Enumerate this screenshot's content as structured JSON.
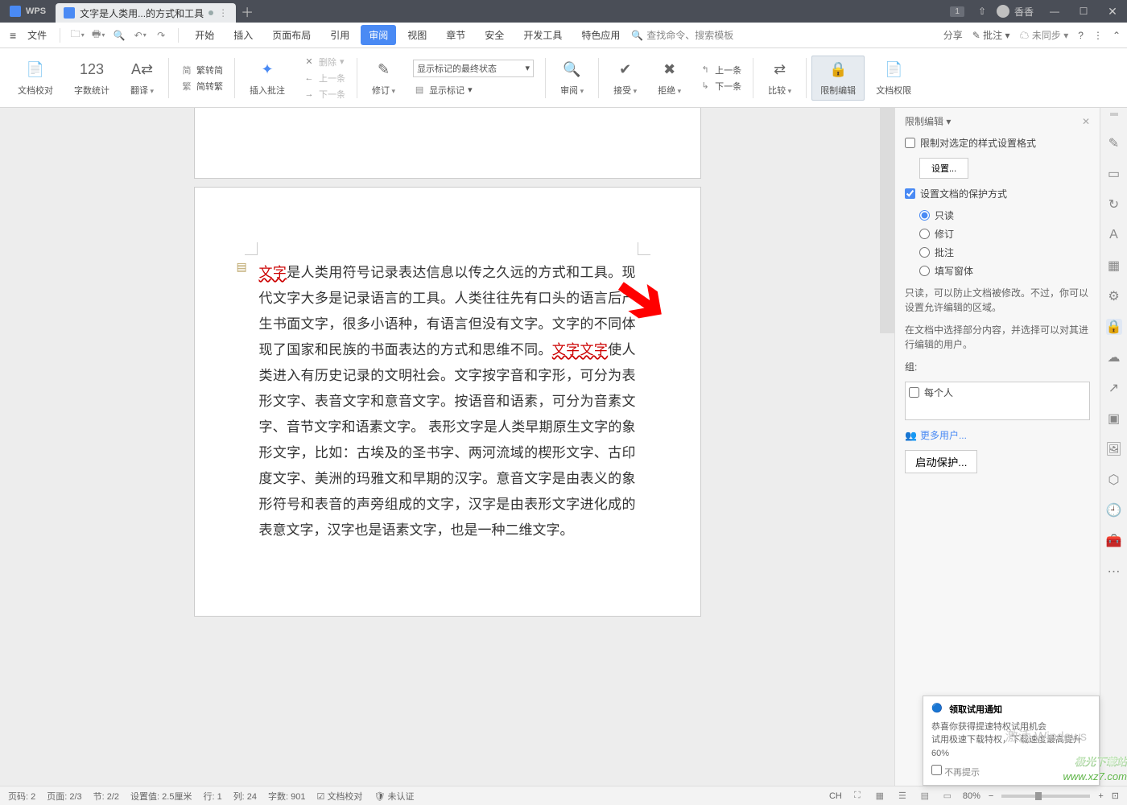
{
  "app": {
    "name": "WPS",
    "tab_title": "文字是人类用...的方式和工具",
    "user": "香香"
  },
  "window_controls": {
    "badge": "1"
  },
  "menubar": {
    "file": "文件",
    "items": [
      "开始",
      "插入",
      "页面布局",
      "引用",
      "审阅",
      "视图",
      "章节",
      "安全",
      "开发工具",
      "特色应用"
    ],
    "active": "审阅",
    "search": "查找命令、搜索模板",
    "share": "分享",
    "comment": "批注",
    "unsynced": "未同步"
  },
  "ribbon": {
    "doc_check": "文档校对",
    "word_count": "字数统计",
    "translate": "翻译",
    "s2t": "繁转简",
    "t2s": "简转繁",
    "insert_comment": "插入批注",
    "delete": "删除",
    "prev_comment": "上一条",
    "next_comment": "下一条",
    "revise": "修订",
    "markup_state": "显示标记的最终状态",
    "show_markup": "显示标记",
    "review": "审阅",
    "accept": "接受",
    "reject": "拒绝",
    "prev_change": "上一条",
    "next_change": "下一条",
    "compare": "比较",
    "restrict_edit": "限制编辑",
    "doc_perm": "文档权限"
  },
  "document": {
    "text1_red": "文字",
    "text1": "是人类用符号记录表达信息以传之久远的方式和工具。现代文字大多是记录语言的工具。人类往往先有口头的语言后产生书面文字，很多小语种，有语言但没有文字。文字的不同体现了国家和民族的书面表达的方式和思维不同。",
    "text2_red": "文字文字",
    "text2": "使人类进入有历史记录的文明社会。文字按字音和字形，可分为表形文字、表音文字和意音文字。按语音和语素，可分为音素文字、音节文字和语素文字。 表形文字是人类早期原生文字的象形文字，比如：古埃及的圣书字、两河流域的楔形文字、古印度文字、美洲的玛雅文和早期的汉字。意音文字是由表义的象形符号和表音的声旁组成的文字，汉字是由表形文字进化成的表意文字，汉字也是语素文字，也是一种二维文字。"
  },
  "panel": {
    "title": "限制编辑",
    "restrict_style": "限制对选定的样式设置格式",
    "settings": "设置...",
    "set_protect": "设置文档的保护方式",
    "readonly": "只读",
    "revise_r": "修订",
    "comment_r": "批注",
    "form_r": "填写窗体",
    "readonly_hint": "只读，可以防止文档被修改。不过，你可以设置允许编辑的区域。",
    "select_hint": "在文档中选择部分内容，并选择可以对其进行编辑的用户。",
    "group_label": "组:",
    "everyone": "每个人",
    "more_users": "更多用户...",
    "start_protect": "启动保护..."
  },
  "notice": {
    "title": "领取试用通知",
    "line1": "恭喜你获得提速特权试用机会",
    "line2": "试用极速下载特权，下载速度最高提升60%",
    "no_remind": "不再提示"
  },
  "watermark": "激活 Windows",
  "site": {
    "l1": "极光下载站",
    "l2": "www.xz7.com"
  },
  "statusbar": {
    "page_no": "页码: 2",
    "page": "页面: 2/3",
    "section": "节: 2/2",
    "setting": "设置值: 2.5厘米",
    "row": "行: 1",
    "col": "列: 24",
    "words": "字数: 901",
    "doc_check": "文档校对",
    "unverified": "未认证",
    "zoom": "80%",
    "ime": "CH"
  }
}
